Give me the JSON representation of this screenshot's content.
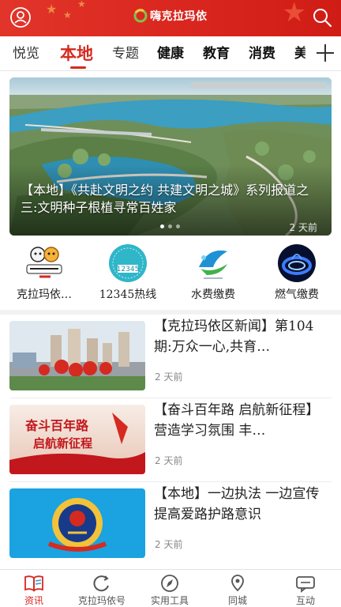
{
  "header": {
    "logo_text": "嗨克拉玛依",
    "user_icon": "user-icon",
    "search_icon": "search-icon",
    "brand_color": "#d9261e"
  },
  "tabs": [
    {
      "label": "悦览"
    },
    {
      "label": "本地",
      "active": true
    },
    {
      "label": "专题"
    },
    {
      "label": "健康"
    },
    {
      "label": "教育"
    },
    {
      "label": "消费"
    },
    {
      "label": "美"
    }
  ],
  "add_tab_icon": "plus-icon",
  "banner": {
    "title": "【本地】《共赴文明之约 共建文明之城》系列报道之三:文明种子根植寻常百姓家",
    "time": "2 天前",
    "slide_count": 3,
    "active_slide": 1
  },
  "quick_links": [
    {
      "label": "克拉玛依…",
      "icon": "klmy-mascot-icon"
    },
    {
      "label": "12345热线",
      "icon": "hotline-12345-icon",
      "icon_text": "12345"
    },
    {
      "label": "水费缴费",
      "icon": "water-bill-icon"
    },
    {
      "label": "燃气缴费",
      "icon": "gas-flame-icon"
    }
  ],
  "news": [
    {
      "title": "【克拉玛依区新闻】第104期:万众一心,共育…",
      "time": "2 天前",
      "thumb": "city-lanterns-photo"
    },
    {
      "title": "【奋斗百年路 启航新征程】营造学习氛围 丰…",
      "time": "2 天前",
      "thumb": "centenary-banner",
      "thumb_text": [
        "奋斗百年路",
        "启航新征程"
      ]
    },
    {
      "title": "【本地】一边执法 一边宣传 提高爱路护路意识",
      "time": "2 天前",
      "thumb": "police-emblem-photo"
    }
  ],
  "bottom_nav": [
    {
      "label": "资讯",
      "icon": "book-icon",
      "active": true
    },
    {
      "label": "克拉玛依号",
      "icon": "refresh-icon"
    },
    {
      "label": "实用工具",
      "icon": "compass-icon"
    },
    {
      "label": "同城",
      "icon": "location-icon"
    },
    {
      "label": "互动",
      "icon": "chat-icon"
    }
  ],
  "colors": {
    "accent": "#d52a20",
    "active_tab": "#d52a20"
  }
}
